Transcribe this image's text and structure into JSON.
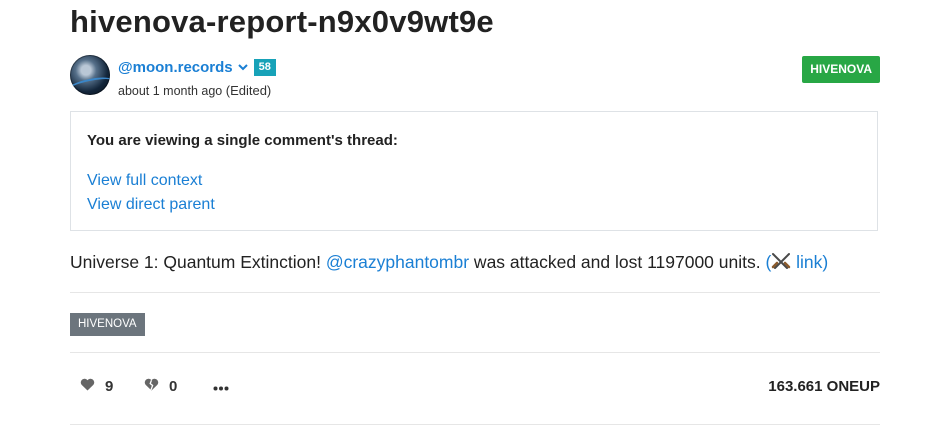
{
  "post": {
    "title": "hivenova-report-n9x0v9wt9e",
    "community_badge": "HIVENOVA"
  },
  "author": {
    "name": "@moon.records",
    "reputation": "58",
    "timestamp": "about 1 month ago",
    "edited_label": "(Edited)"
  },
  "thread": {
    "heading": "You are viewing a single comment's thread:",
    "full_context_label": "View full context",
    "direct_parent_label": "View direct parent"
  },
  "body": {
    "prefix": "Universe 1: Quantum Extinction! ",
    "mention": "@crazyphantombr",
    "middle": " was attacked and lost 1197000 units. ",
    "link_open": "(",
    "link_label": " link)"
  },
  "tags": [
    "HIVENOVA"
  ],
  "footer": {
    "upvotes": "9",
    "downvotes": "0",
    "payout": "163.661 ONEUP"
  },
  "colors": {
    "link": "#1a7fd4",
    "community_badge": "#28a745",
    "reputation_badge": "#17a2b8",
    "tag": "#6c757d"
  },
  "icons": {
    "upvote": "heart-icon",
    "downvote": "broken-heart-icon",
    "more": "ellipsis-icon",
    "battle": "crossed-swords-icon",
    "author_menu": "chevron-down-icon"
  }
}
